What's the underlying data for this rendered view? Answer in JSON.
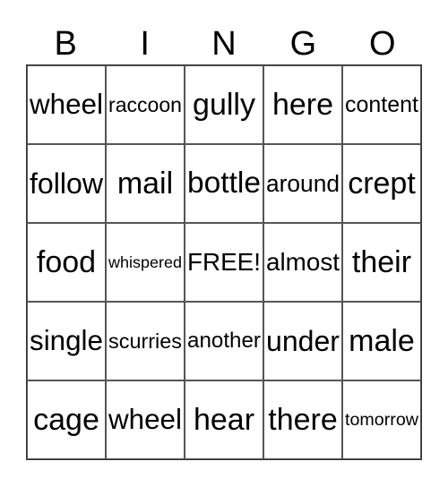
{
  "header": [
    "B",
    "I",
    "N",
    "G",
    "O"
  ],
  "cells": [
    [
      "wheel",
      "raccoon",
      "gully",
      "here",
      "content"
    ],
    [
      "follow",
      "mail",
      "bottle",
      "around",
      "crept"
    ],
    [
      "food",
      "whispered",
      "FREE!",
      "almost",
      "their"
    ],
    [
      "single",
      "scurries",
      "another",
      "under",
      "male"
    ],
    [
      "cage",
      "wheel",
      "hear",
      "there",
      "tomorrow"
    ]
  ]
}
